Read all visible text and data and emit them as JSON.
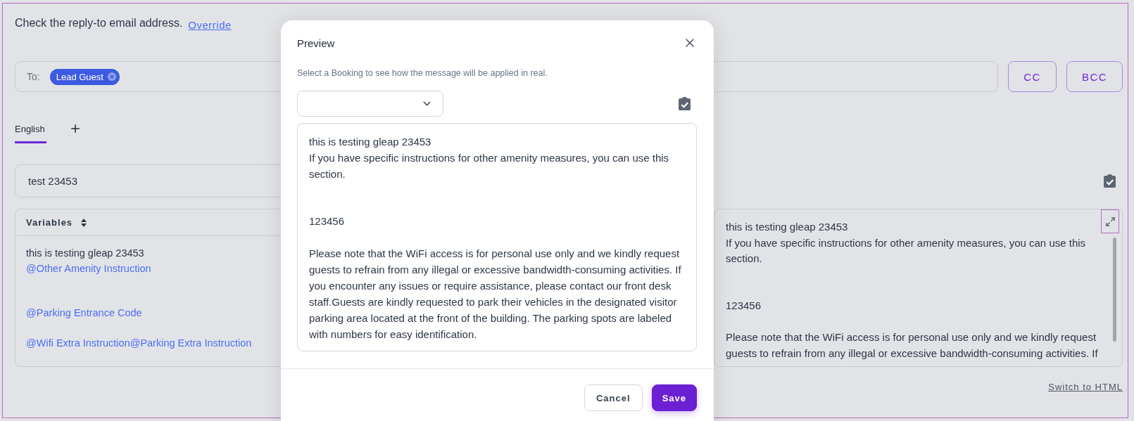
{
  "notice": {
    "text": "Check the reply-to email address.",
    "link": "Override"
  },
  "recipients": {
    "label": "To:",
    "chips": [
      {
        "label": "Lead Guest"
      }
    ]
  },
  "recipient_buttons": [
    "CC",
    "BCC"
  ],
  "language_tabs": [
    {
      "label": "English",
      "selected": true
    }
  ],
  "subject": {
    "value": "test 23453"
  },
  "variables": {
    "header": "Variables",
    "lines": [
      {
        "kind": "text",
        "text": "this is testing gleap 23453"
      },
      {
        "kind": "variable",
        "text": "@Other Amenity Instruction"
      },
      {
        "kind": "variable",
        "text": "@Parking Entrance Code"
      },
      {
        "kind": "variable",
        "text": "@Wifi Extra Instruction@Parking Extra Instruction"
      }
    ]
  },
  "preview_panel": {
    "paragraphs": [
      "this is testing gleap 23453",
      "If you have specific instructions for other amenity measures, you can use this section.",
      "123456",
      "Please note that the WiFi access is for personal use only and we kindly request guests to refrain from any illegal or excessive bandwidth-consuming activities. If"
    ]
  },
  "switch_link": "Switch to HTML",
  "modal": {
    "title": "Preview",
    "subtitle": "Select a Booking to see how the message will be applied in real.",
    "paragraphs": [
      "this is testing gleap 23453",
      "If you have specific instructions for other amenity measures, you can use this section.",
      "123456",
      "Please note that the WiFi access is for personal use only and we kindly request guests to refrain from any illegal or excessive bandwidth-consuming activities. If you encounter any issues or require assistance, please contact our front desk staff.Guests are kindly requested to park their vehicles in the designated visitor parking area located at the front of the building. The parking spots are labeled with numbers for easy identification."
    ],
    "buttons": [
      {
        "kind": "secondary",
        "label": "Cancel"
      },
      {
        "kind": "primary",
        "label": "Save"
      }
    ]
  }
}
